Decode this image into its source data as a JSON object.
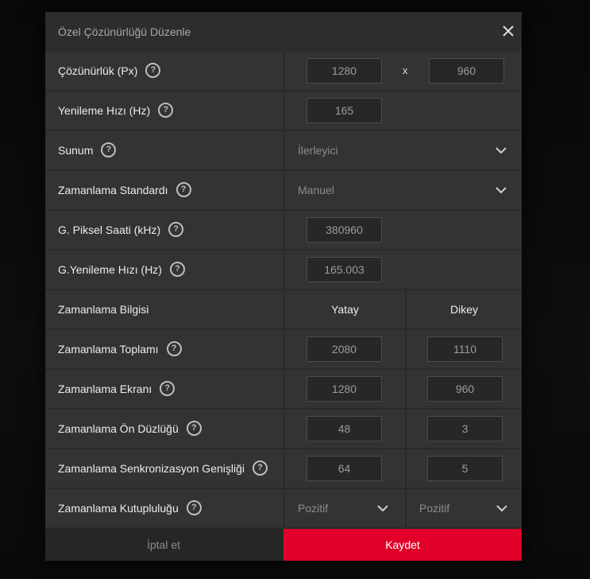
{
  "dialog": {
    "title": "Özel Çözünürlüğü Düzenle",
    "close_icon": "close-icon"
  },
  "resolution": {
    "label": "Çözünürlük (Px)",
    "width": "1280",
    "separator": "x",
    "height": "960"
  },
  "refresh_rate": {
    "label": "Yenileme Hızı (Hz)",
    "value": "165"
  },
  "presentation": {
    "label": "Sunum",
    "value": "İlerleyici"
  },
  "timing_standard": {
    "label": "Zamanlama Standardı",
    "value": "Manuel"
  },
  "pixel_clock": {
    "label": "G. Piksel Saati (kHz)",
    "value": "380960"
  },
  "actual_refresh": {
    "label": "G.Yenileme Hızı (Hz)",
    "value": "165.003"
  },
  "timing_info": {
    "label": "Zamanlama Bilgisi",
    "horizontal": "Yatay",
    "vertical": "Dikey"
  },
  "timing_total": {
    "label": "Zamanlama Toplamı",
    "h": "2080",
    "v": "1110"
  },
  "timing_display": {
    "label": "Zamanlama Ekranı",
    "h": "1280",
    "v": "960"
  },
  "timing_front_porch": {
    "label": "Zamanlama Ön Düzlüğü",
    "h": "48",
    "v": "3"
  },
  "timing_sync_width": {
    "label": "Zamanlama Senkronizasyon Genişliği",
    "h": "64",
    "v": "5"
  },
  "timing_polarity": {
    "label": "Zamanlama Kutupluluğu",
    "h": "Pozitif",
    "v": "Pozitif"
  },
  "help_glyph": "?",
  "footer": {
    "cancel_label": "İptal et",
    "save_label": "Kaydet"
  },
  "colors": {
    "accent": "#e0002a",
    "panel": "#333333",
    "background": "#0b0b0b"
  }
}
